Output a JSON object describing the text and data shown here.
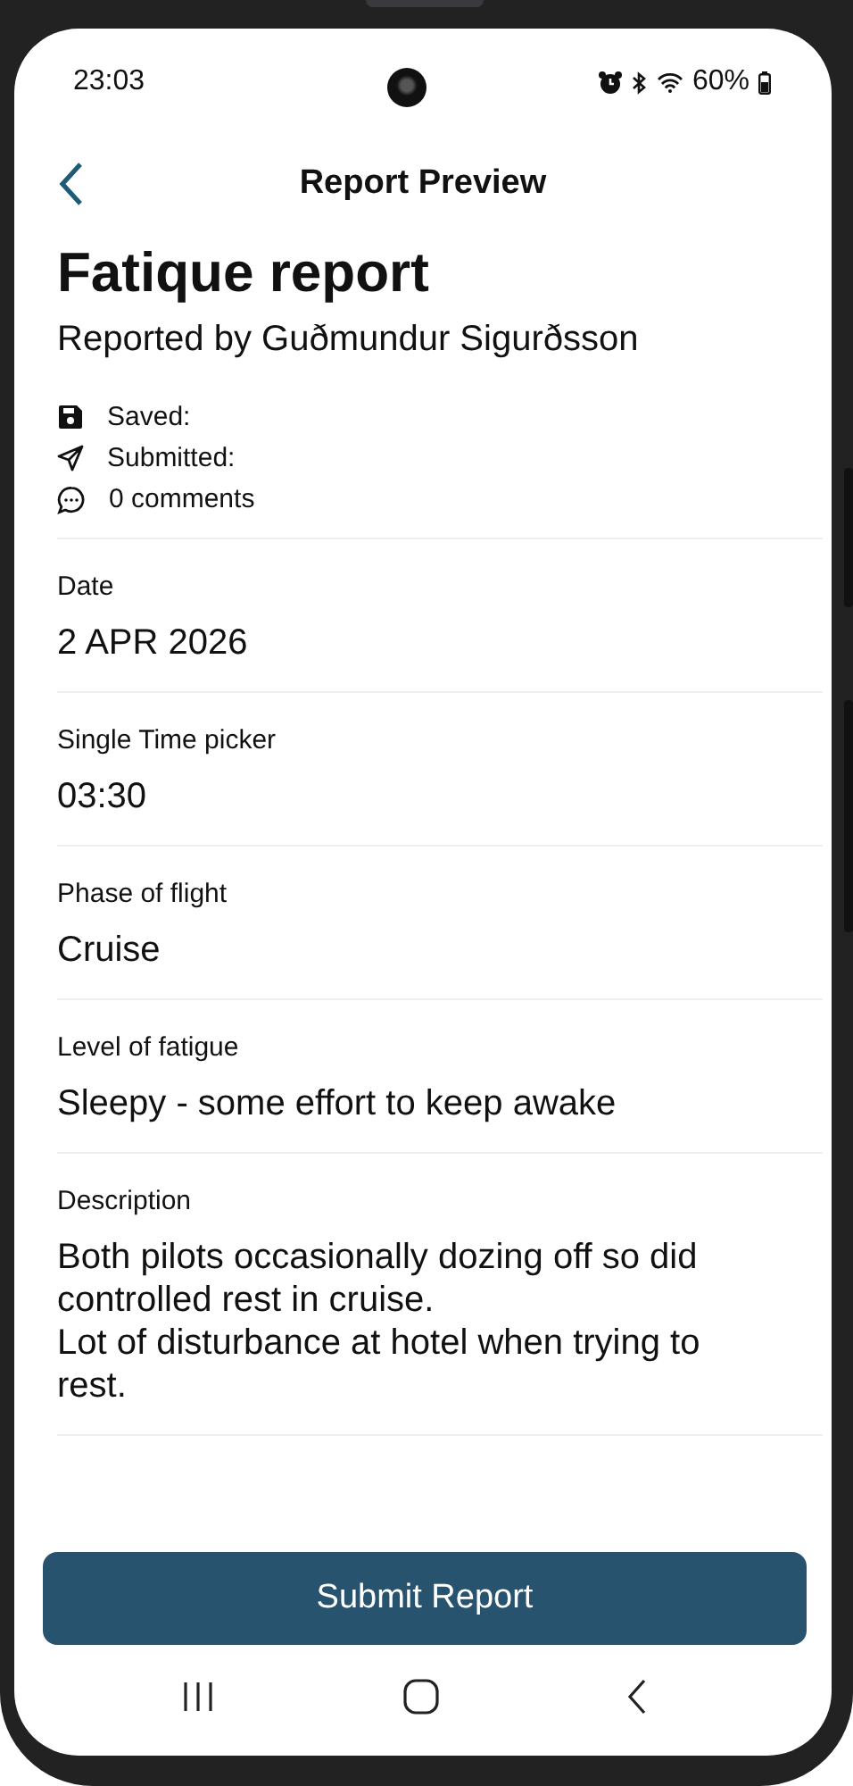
{
  "status_bar": {
    "time": "23:03",
    "battery": "60%"
  },
  "header": {
    "title": "Report Preview"
  },
  "report": {
    "title": "Fatique report",
    "reporter": "Reported by Guðmundur Sigurðsson"
  },
  "meta": [
    {
      "kind": "saved",
      "text": "Saved:"
    },
    {
      "kind": "submitted",
      "text": "Submitted:"
    },
    {
      "kind": "comments",
      "text": "0 comments"
    }
  ],
  "fields": [
    {
      "label": "Date",
      "value": "2 APR 2026"
    },
    {
      "label": "Single Time picker",
      "value": "03:30"
    },
    {
      "label": "Phase of flight",
      "value": "Cruise"
    },
    {
      "label": "Level of fatigue",
      "value": "Sleepy - some effort to keep awake"
    },
    {
      "label": "Description",
      "value": "Both pilots occasionally dozing off so did controlled rest in cruise.\nLot of disturbance at hotel when trying to rest."
    }
  ],
  "submit_button": "Submit Report"
}
